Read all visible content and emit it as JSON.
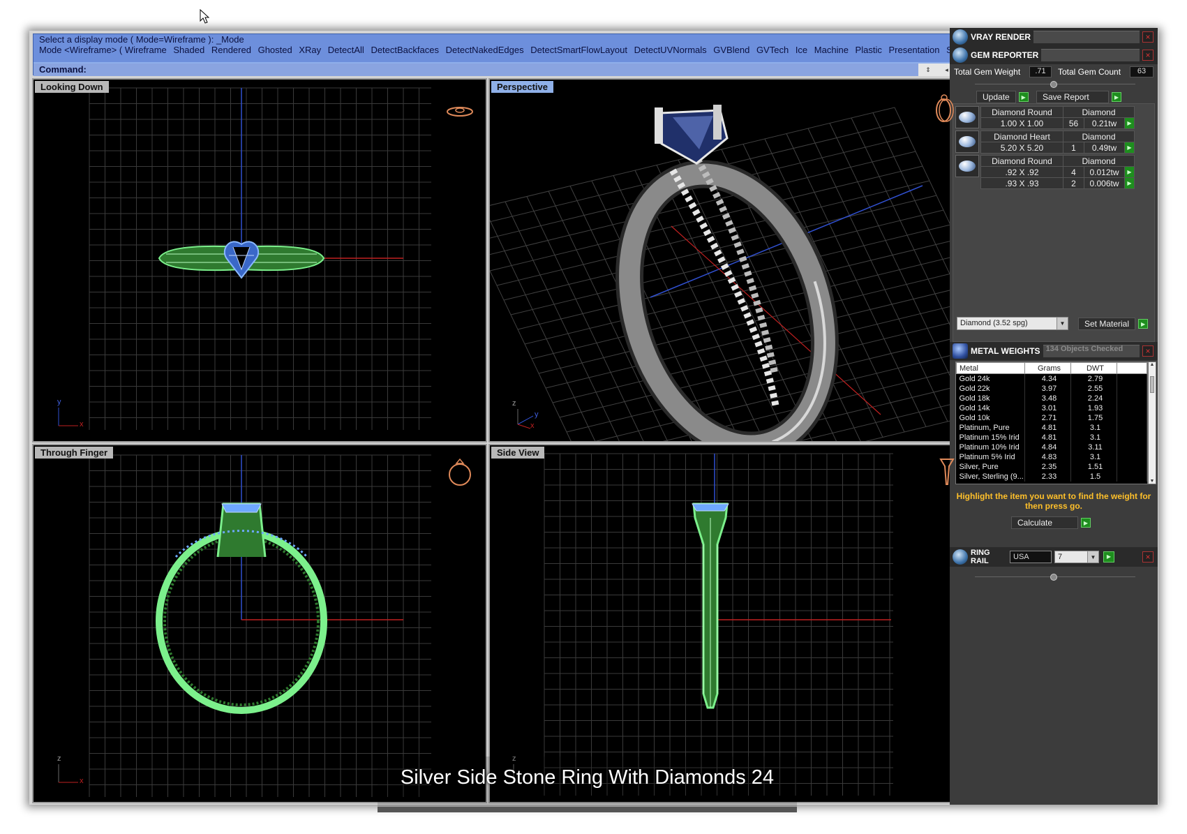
{
  "command": {
    "line1": "Select a display mode ( Mode=Wireframe ): _Mode",
    "line2_prefix": "Mode <Wireframe> ( Wireframe",
    "line2_options": [
      "Shaded",
      "Rendered",
      "Ghosted",
      "XRay",
      "DetectAll",
      "DetectBackfaces",
      "DetectNakedEdges",
      "DetectSmartFlowLayout",
      "DetectUVNormals",
      "GVBlend",
      "GVTech",
      "Ice",
      "Machine",
      "Plastic",
      "Presentation",
      "S"
    ],
    "prompt": "Command:"
  },
  "viewports": {
    "top_left": "Looking Down",
    "top_right": "Perspective",
    "bottom_left": "Through Finger",
    "bottom_right": "Side View"
  },
  "axis_labels": {
    "x": "x",
    "y": "y",
    "z": "z"
  },
  "caption": "Silver Side Stone Ring With Diamonds 24",
  "panels": {
    "vray": "VRAY RENDER",
    "gem": "GEM REPORTER",
    "metal": "METAL WEIGHTS",
    "metal_info": "134 Objects Checked",
    "ring": "RING RAIL"
  },
  "gem_reporter": {
    "total_weight_label": "Total Gem Weight",
    "total_weight": ".71",
    "total_count_label": "Total Gem Count",
    "total_count": "63",
    "update_label": "Update",
    "save_label": "Save Report",
    "gems": [
      {
        "name": "Diamond Round",
        "material": "Diamond",
        "rows": [
          {
            "size": "1.00 X 1.00",
            "count": "56",
            "weight": "0.21tw"
          }
        ]
      },
      {
        "name": "Diamond Heart",
        "material": "Diamond",
        "rows": [
          {
            "size": "5.20 X 5.20",
            "count": "1",
            "weight": "0.49tw"
          }
        ]
      },
      {
        "name": "Diamond Round",
        "material": "Diamond",
        "rows": [
          {
            "size": ".92 X .92",
            "count": "4",
            "weight": "0.012tw"
          },
          {
            "size": ".93 X .93",
            "count": "2",
            "weight": "0.006tw"
          }
        ]
      }
    ],
    "material_select": "Diamond    (3.52 spg)",
    "set_material_label": "Set Material"
  },
  "metal_weights": {
    "headers": [
      "Metal",
      "Grams",
      "DWT"
    ],
    "rows": [
      [
        "Gold 24k",
        "4.34",
        "2.79"
      ],
      [
        "Gold 22k",
        "3.97",
        "2.55"
      ],
      [
        "Gold 18k",
        "3.48",
        "2.24"
      ],
      [
        "Gold 14k",
        "3.01",
        "1.93"
      ],
      [
        "Gold 10k",
        "2.71",
        "1.75"
      ],
      [
        "Platinum, Pure",
        "4.81",
        "3.1"
      ],
      [
        "Platinum 15% Irid",
        "4.81",
        "3.1"
      ],
      [
        "Platinum 10% Irid",
        "4.84",
        "3.11"
      ],
      [
        "Platinum 5% Irid",
        "4.83",
        "3.1"
      ],
      [
        "Silver, Pure",
        "2.35",
        "1.51"
      ],
      [
        "Silver, Sterling (9...",
        "2.33",
        "1.5"
      ]
    ],
    "hint": "Highlight the item you want to find the weight for then press go.",
    "calculate_label": "Calculate"
  },
  "ring_rail": {
    "region": "USA",
    "size": "7"
  },
  "colors": {
    "wire": "#7cf08c",
    "stone": "#6ea8ff",
    "grid": "#3a3a3a",
    "accent": "#1e8e1e"
  }
}
